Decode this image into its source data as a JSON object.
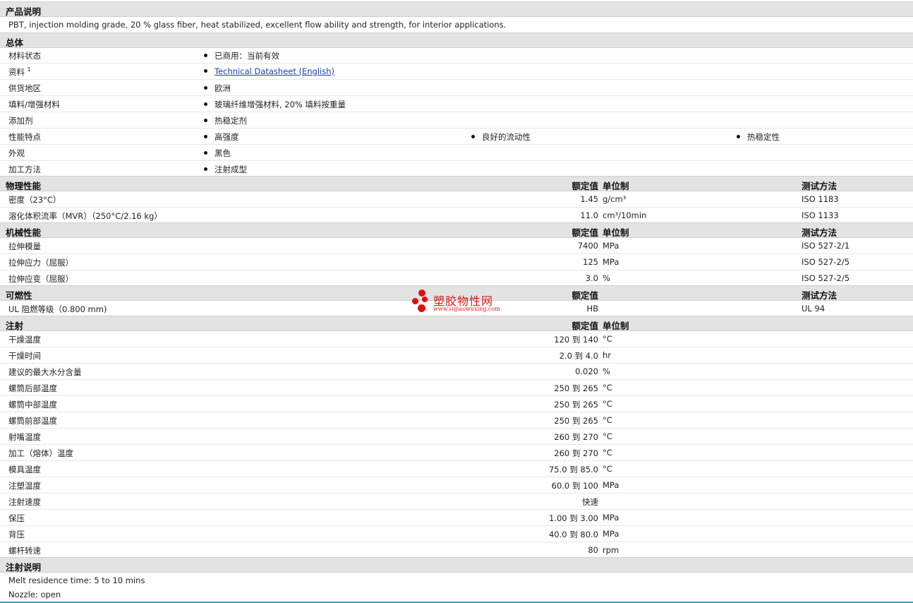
{
  "product_desc": {
    "header": "产品说明",
    "text": "PBT, injection molding grade, 20 % glass fiber, heat stabilized, excellent flow ability and strength, for interior applications."
  },
  "general": {
    "header": "总体",
    "rows": [
      {
        "label": "材料状态",
        "values": [
          "已商用：当前有效"
        ]
      },
      {
        "label": "资料",
        "sup": "1",
        "link": "Technical Datasheet (English)"
      },
      {
        "label": "供货地区",
        "values": [
          "欧洲"
        ]
      },
      {
        "label": "填料/增强材料",
        "values": [
          "玻璃纤维增强材料, 20% 填料按重量"
        ]
      },
      {
        "label": "添加剂",
        "values": [
          "热稳定剂"
        ]
      },
      {
        "label": "性能特点",
        "values": [
          "高强度",
          "良好的流动性",
          "热稳定性"
        ]
      },
      {
        "label": "外观",
        "values": [
          "黑色"
        ]
      },
      {
        "label": "加工方法",
        "values": [
          "注射成型"
        ]
      }
    ]
  },
  "physical": {
    "header": "物理性能",
    "col_value": "额定值",
    "col_unit": "单位制",
    "col_test": "测试方法",
    "rows": [
      {
        "label": "密度（23°C）",
        "value": "1.45",
        "unit": "g/cm³",
        "test": "ISO 1183"
      },
      {
        "label": "溶化体积流率（MVR）（250°C/2.16 kg）",
        "value": "11.0",
        "unit": "cm³/10min",
        "test": "ISO 1133"
      }
    ]
  },
  "mechanical": {
    "header": "机械性能",
    "col_value": "额定值",
    "col_unit": "单位制",
    "col_test": "测试方法",
    "rows": [
      {
        "label": "拉伸模量",
        "value": "7400",
        "unit": "MPa",
        "test": "ISO 527-2/1"
      },
      {
        "label": "拉伸应力（屈服）",
        "value": "125",
        "unit": "MPa",
        "test": "ISO 527-2/5"
      },
      {
        "label": "拉伸应变（屈服）",
        "value": "3.0",
        "unit": "%",
        "test": "ISO 527-2/5"
      }
    ]
  },
  "flammability": {
    "header": "可燃性",
    "col_value": "额定值",
    "col_test": "测试方法",
    "rows": [
      {
        "label": "UL 阻燃等级（0.800 mm)",
        "value": "HB",
        "unit": "",
        "test": "UL 94"
      }
    ]
  },
  "injection": {
    "header": "注射",
    "col_value": "额定值",
    "col_unit": "单位制",
    "rows": [
      {
        "label": "干燥温度",
        "value": "120 到  140",
        "unit": "°C"
      },
      {
        "label": "干燥时间",
        "value": "2.0 到  4.0",
        "unit": "hr"
      },
      {
        "label": "建议的最大水分含量",
        "value": "0.020",
        "unit": "%"
      },
      {
        "label": "螺筒后部温度",
        "value": "250 到  265",
        "unit": "°C"
      },
      {
        "label": "螺筒中部温度",
        "value": "250 到  265",
        "unit": "°C"
      },
      {
        "label": "螺筒前部温度",
        "value": "250 到  265",
        "unit": "°C"
      },
      {
        "label": "射嘴温度",
        "value": "260 到  270",
        "unit": "°C"
      },
      {
        "label": "加工（熔体）温度",
        "value": "260 到  270",
        "unit": "°C"
      },
      {
        "label": "模具温度",
        "value": "75.0 到  85.0",
        "unit": "°C"
      },
      {
        "label": "注塑温度",
        "value": "60.0 到  100",
        "unit": "MPa"
      },
      {
        "label": "注射速度",
        "value": "快速",
        "unit": ""
      },
      {
        "label": "保压",
        "value": "1.00 到  3.00",
        "unit": "MPa"
      },
      {
        "label": "背压",
        "value": "40.0 到  80.0",
        "unit": "MPa"
      },
      {
        "label": "螺杆转速",
        "value": "80",
        "unit": "rpm"
      }
    ]
  },
  "injection_notes": {
    "header": "注射说明",
    "lines": [
      "Melt residence time: 5 to 10 mins",
      "Nozzle: open"
    ]
  },
  "watermark": {
    "title": "塑胶物性网",
    "url": "www.sujiaowuxing.com"
  }
}
